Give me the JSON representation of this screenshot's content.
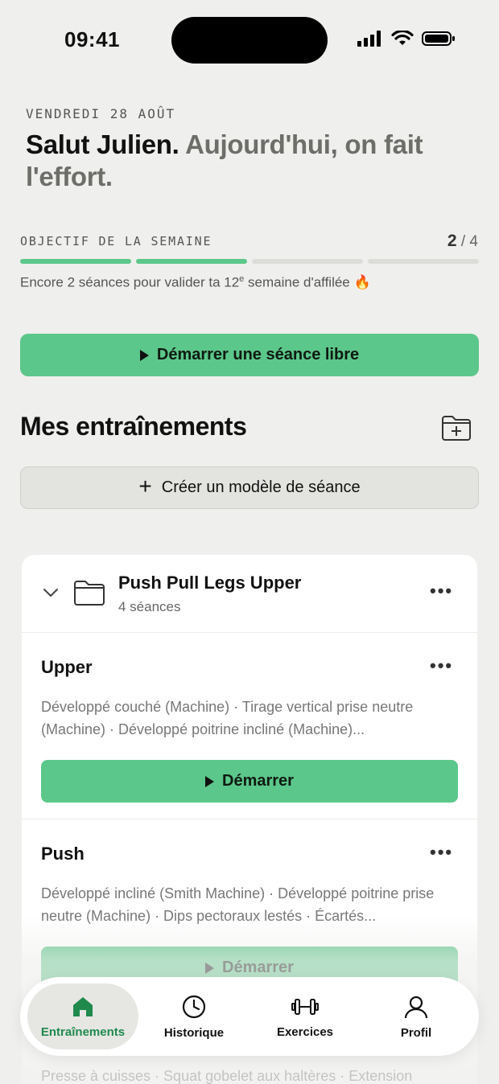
{
  "status": {
    "time": "09:41"
  },
  "header": {
    "date": "VENDREDI 28 AOÛT",
    "greeting_name": "Salut Julien.",
    "greeting_sub": "Aujourd'hui, on fait l'effort."
  },
  "goal": {
    "label": "OBJECTIF DE LA SEMAINE",
    "done": "2",
    "separator": " / ",
    "total": "4",
    "progress": 0.5,
    "note_before": "Encore 2 séances pour valider ta 12",
    "note_sup": "e",
    "note_after": " semaine d'affilée 🔥"
  },
  "actions": {
    "start_free_label": "Démarrer une séance libre",
    "create_template_label": "Créer un modèle de séance"
  },
  "section": {
    "title": "Mes entraînements"
  },
  "folder": {
    "name": "Push Pull Legs Upper",
    "count": "4 séances"
  },
  "workouts": [
    {
      "name": "Upper",
      "description": "Développé couché (Machine) · Tirage vertical prise neutre (Machine) · Développé poitrine incliné (Machine)...",
      "start_label": "Démarrer"
    },
    {
      "name": "Push",
      "description": "Développé incliné (Smith Machine) · Développé poitrine prise neutre (Machine) · Dips pectoraux lestés · Écartés...",
      "start_label": "Démarrer"
    }
  ],
  "next_workout_desc": "Presse à cuisses · Squat gobelet aux haltères · Extension",
  "tabs": [
    {
      "label": "Entraînements",
      "icon": "home-icon",
      "active": true
    },
    {
      "label": "Historique",
      "icon": "clock-icon",
      "active": false
    },
    {
      "label": "Exercices",
      "icon": "dumbbell-icon",
      "active": false
    },
    {
      "label": "Profil",
      "icon": "user-icon",
      "active": false
    }
  ],
  "colors": {
    "accent": "#5cc78a",
    "active_tab": "#1f8a4c",
    "background": "#efefed"
  }
}
